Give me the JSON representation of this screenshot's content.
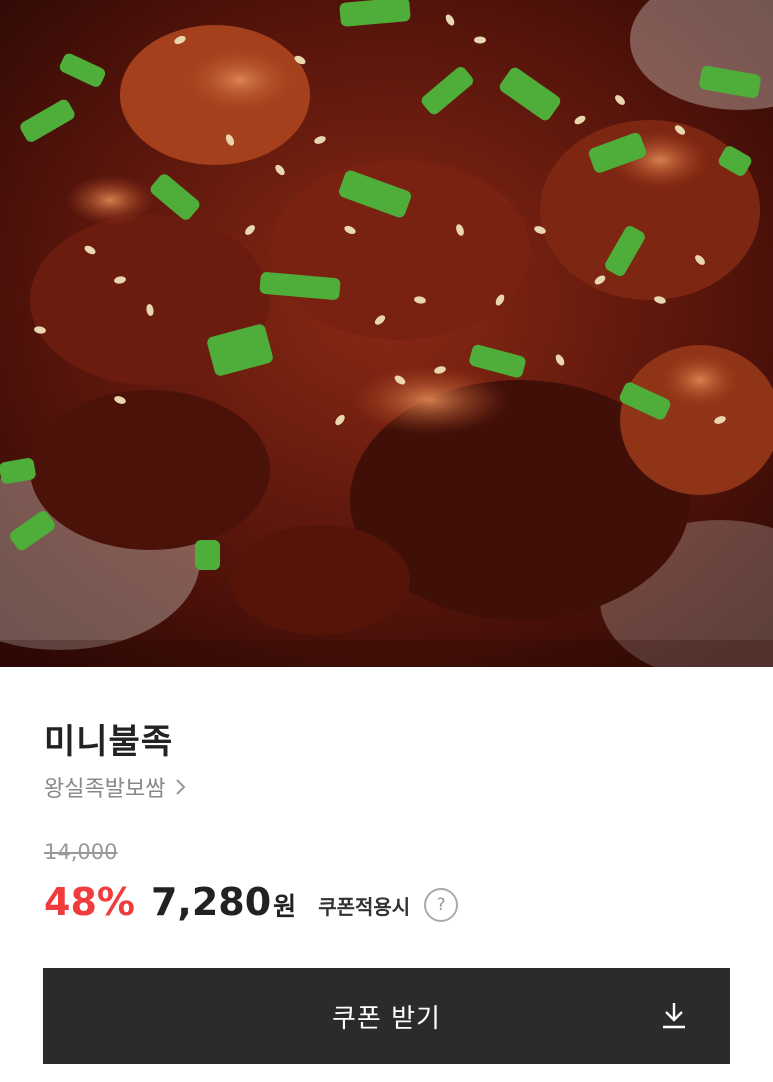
{
  "product": {
    "name": "미니불족",
    "store_name": "왕실족발보쌈",
    "image_icon": "food-photo"
  },
  "pricing": {
    "original_price": "14,000",
    "discount_rate": "48%",
    "sale_price": "7,280",
    "currency": "원",
    "coupon_note": "쿠폰적용시",
    "help_symbol": "?"
  },
  "coupon_button": {
    "label": "쿠폰 받기",
    "icon": "download-icon"
  },
  "colors": {
    "discount": "#f03c3c",
    "button_bg": "#2b2b2b",
    "muted_text": "#888888"
  }
}
